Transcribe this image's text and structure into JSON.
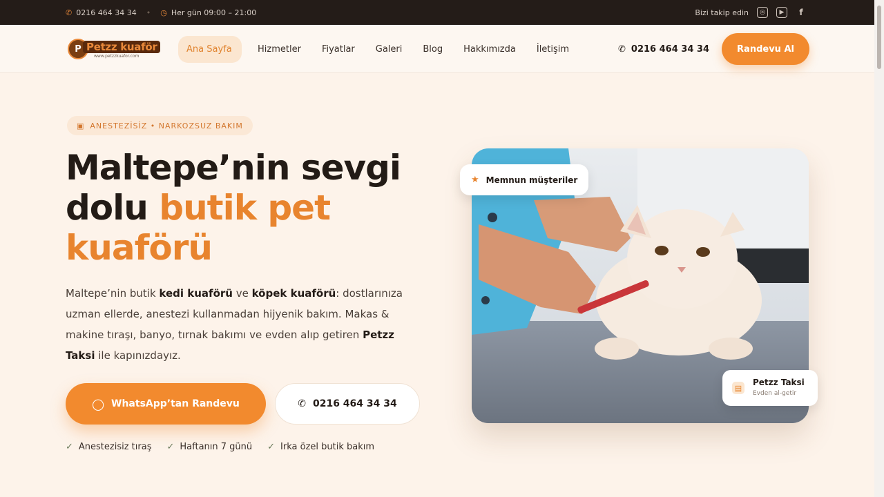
{
  "topbar": {
    "phone": "0216 464 34 34",
    "hours": "Her gün 09:00 – 21:00",
    "follow_label": "Bizi takip edin"
  },
  "header": {
    "logo_text": "Petzz kuaför",
    "logo_site": "www.petzzkuafor.com",
    "nav": [
      "Ana Sayfa",
      "Hizmetler",
      "Fiyatlar",
      "Galeri",
      "Blog",
      "Hakkımızda",
      "İletişim"
    ],
    "phone": "0216 464 34 34",
    "cta_label": "Randevu Al"
  },
  "hero": {
    "pill": "ANESTEZİSİZ • NARKOZSUZ BAKIM",
    "headline_part1": "Maltepe’nin sevgi dolu ",
    "headline_accent": "butik pet kuaförü",
    "lead_1": "Maltepe’nin butik ",
    "lead_b1": "kedi kuaförü",
    "lead_2": " ve ",
    "lead_b2": "köpek kuaförü",
    "lead_3": ": dostlarınıza uzman ellerde, anestezi kullanmadan hijyenik bakım. Makas & makine tıraşı, banyo, tırnak bakımı ve evden alıp getiren ",
    "lead_b3": "Petzz Taksi",
    "lead_4": " ile kapınızdayız.",
    "whatsapp_label": "WhatsApp’tan Randevu",
    "phone_label": "0216 464 34 34",
    "checks": [
      "Anestezisiz tıraş",
      "Haftanın 7 günü",
      "Irka özel butik bakım"
    ]
  },
  "badges": {
    "happy": "Memnun müşteriler",
    "taxi_title": "Petzz Taksi",
    "taxi_sub": "Evden al-getir"
  },
  "colors": {
    "accent": "#f28a2e",
    "dark": "#241c18",
    "bg": "#fdf3ea"
  }
}
